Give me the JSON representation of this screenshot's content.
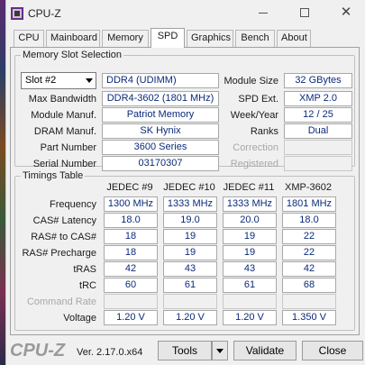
{
  "window": {
    "title": "CPU-Z"
  },
  "tabs": [
    "CPU",
    "Mainboard",
    "Memory",
    "SPD",
    "Graphics",
    "Bench",
    "About"
  ],
  "slot": {
    "group_title": "Memory Slot Selection",
    "selected": "Slot #2",
    "type": "DDR4 (UDIMM)",
    "module_size_label": "Module Size",
    "module_size": "32 GBytes",
    "max_bandwidth_label": "Max Bandwidth",
    "max_bandwidth": "DDR4-3602 (1801 MHz)",
    "spd_ext_label": "SPD Ext.",
    "spd_ext": "XMP 2.0",
    "module_manuf_label": "Module Manuf.",
    "module_manuf": "Patriot Memory",
    "week_year_label": "Week/Year",
    "week_year": "12 / 25",
    "dram_manuf_label": "DRAM Manuf.",
    "dram_manuf": "SK Hynix",
    "ranks_label": "Ranks",
    "ranks": "Dual",
    "part_number_label": "Part Number",
    "part_number": "3600 Series",
    "correction_label": "Correction",
    "serial_number_label": "Serial Number",
    "serial_number": "03170307",
    "registered_label": "Registered"
  },
  "timings": {
    "group_title": "Timings Table",
    "columns": [
      "JEDEC #9",
      "JEDEC #10",
      "JEDEC #11",
      "XMP-3602"
    ],
    "rows": [
      {
        "label": "Frequency",
        "values": [
          "1300 MHz",
          "1333 MHz",
          "1333 MHz",
          "1801 MHz"
        ]
      },
      {
        "label": "CAS# Latency",
        "values": [
          "18.0",
          "19.0",
          "20.0",
          "18.0"
        ]
      },
      {
        "label": "RAS# to CAS#",
        "values": [
          "18",
          "19",
          "19",
          "22"
        ]
      },
      {
        "label": "RAS# Precharge",
        "values": [
          "18",
          "19",
          "19",
          "22"
        ]
      },
      {
        "label": "tRAS",
        "values": [
          "42",
          "43",
          "43",
          "42"
        ]
      },
      {
        "label": "tRC",
        "values": [
          "60",
          "61",
          "61",
          "68"
        ]
      },
      {
        "label": "Command Rate",
        "values": [
          "",
          "",
          "",
          ""
        ]
      },
      {
        "label": "Voltage",
        "values": [
          "1.20 V",
          "1.20 V",
          "1.20 V",
          "1.350 V"
        ]
      }
    ]
  },
  "footer": {
    "logo": "CPU-Z",
    "version": "Ver. 2.17.0.x64",
    "tools_label": "Tools",
    "validate_label": "Validate",
    "close_label": "Close"
  }
}
